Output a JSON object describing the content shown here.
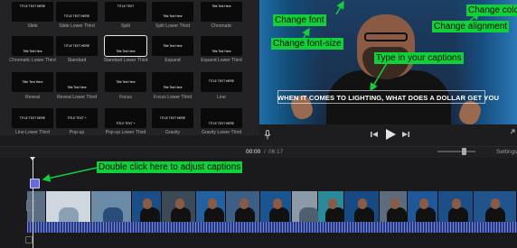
{
  "browser": {
    "tiles": [
      {
        "name": "Slide",
        "text": "TITLE TEXT HERE"
      },
      {
        "name": "Slide Lower Third",
        "text": "TITLE TEXT HERE"
      },
      {
        "name": "Split",
        "text": "TITLE TEXT"
      },
      {
        "name": "Split Lower Third",
        "text": "Title Text Here"
      },
      {
        "name": "Chromatic",
        "text": "Title Text Here"
      },
      {
        "name": "Chromatic Lower Third",
        "text": "Title Text Here"
      },
      {
        "name": "Standard",
        "text": "TITLE TEXT HERE"
      },
      {
        "name": "Standard Lower Third",
        "text": "Title Text Here"
      },
      {
        "name": "Expand",
        "text": "Title Text Here"
      },
      {
        "name": "Expand Lower Third",
        "text": "Title Text Here"
      },
      {
        "name": "Reveal",
        "text": "Title Text Here"
      },
      {
        "name": "Reveal Lower Third",
        "text": "Title Text Here"
      },
      {
        "name": "Focus",
        "text": "Title Text Here"
      },
      {
        "name": "Focus Lower Third",
        "text": "Title Text Here"
      },
      {
        "name": "Line",
        "text": "TITLE TEXT HERE"
      },
      {
        "name": "Line Lower Third",
        "text": "TITLE TEXT HERE"
      },
      {
        "name": "Pop-up",
        "text": "TITLE TEXT +"
      },
      {
        "name": "Pop-up Lower Third",
        "text": "TITLE TEXT +"
      },
      {
        "name": "Gravity",
        "text": "TITLE TEXT HERE"
      },
      {
        "name": "Gravity Lower Third",
        "text": "TITLE TEXT HERE"
      }
    ]
  },
  "viewer": {
    "caption_text": "WHEN IT COMES TO LIGHTING, WHAT DOES A DOLLAR GET YOU"
  },
  "annotations": {
    "change_font": "Change font",
    "change_font_size": "Change font-size",
    "change_color": "Change colo",
    "change_alignment": "Change alignment",
    "type_captions": "Type in your captions",
    "double_click": "Double click here to adjust captions"
  },
  "controls": {
    "mic_icon": "microphone-icon",
    "prev_icon": "skip-back-icon",
    "play_icon": "play-icon",
    "next_icon": "skip-forward-icon",
    "expand_icon": "expand-icon"
  },
  "timeline": {
    "current_time": "00:00",
    "separator": "/",
    "total_time": "06:17",
    "settings_label": "Settings"
  },
  "colors": {
    "annotation_green": "#12d03a",
    "caption_clip": "#6a6ad8",
    "audio_wave": "#7f9bff"
  }
}
